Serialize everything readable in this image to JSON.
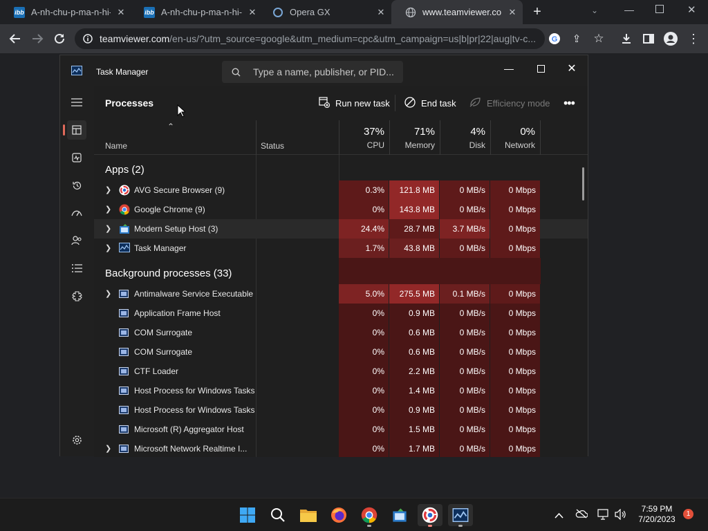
{
  "browser": {
    "tabs": [
      {
        "title": "A-nh-chu-p-ma-n-hi-nh",
        "favicon": "ibb-logo-icon",
        "fav_text": "ibb"
      },
      {
        "title": "A-nh-chu-p-ma-n-hi-nh",
        "favicon": "ibb-logo-icon",
        "fav_text": "ibb"
      },
      {
        "title": "Opera GX",
        "favicon": "opera-gx-icon",
        "fav_text": ""
      },
      {
        "title": "www.teamviewer.com",
        "favicon": "globe-icon",
        "fav_text": ""
      }
    ],
    "url_host": "teamviewer.com",
    "url_rest": "/en-us/?utm_source=google&utm_medium=cpc&utm_campaign=us|b|pr|22|aug|tv-c..."
  },
  "task_manager": {
    "title": "Task Manager",
    "search_placeholder": "Type a name, publisher, or PID...",
    "page_title": "Processes",
    "commands": {
      "run_new_task": "Run new task",
      "end_task": "End task",
      "efficiency_mode": "Efficiency mode"
    },
    "columns": {
      "name": "Name",
      "status": "Status",
      "cpu_pct": "37%",
      "cpu": "CPU",
      "memory_pct": "71%",
      "memory": "Memory",
      "disk_pct": "4%",
      "disk": "Disk",
      "network_pct": "0%",
      "network": "Network"
    },
    "groups": {
      "apps": "Apps (2)",
      "background": "Background processes (33)"
    },
    "apps": [
      {
        "name": "AVG Secure Browser (9)",
        "icon": "avg-browser-icon",
        "cpu": "0.3%",
        "memory": "121.8 MB",
        "disk": "0 MB/s",
        "network": "0 Mbps"
      },
      {
        "name": "Google Chrome (9)",
        "icon": "chrome-icon",
        "cpu": "0%",
        "memory": "143.8 MB",
        "disk": "0 MB/s",
        "network": "0 Mbps"
      },
      {
        "name": "Modern Setup Host (3)",
        "icon": "setup-host-icon",
        "cpu": "24.4%",
        "memory": "28.7 MB",
        "disk": "3.7 MB/s",
        "network": "0 Mbps"
      },
      {
        "name": "Task Manager",
        "icon": "task-manager-icon",
        "cpu": "1.7%",
        "memory": "43.8 MB",
        "disk": "0 MB/s",
        "network": "0 Mbps"
      }
    ],
    "background": [
      {
        "name": "Antimalware Service Executable",
        "expandable": true,
        "cpu": "5.0%",
        "memory": "275.5 MB",
        "disk": "0.1 MB/s",
        "network": "0 Mbps"
      },
      {
        "name": "Application Frame Host",
        "expandable": false,
        "cpu": "0%",
        "memory": "0.9 MB",
        "disk": "0 MB/s",
        "network": "0 Mbps"
      },
      {
        "name": "COM Surrogate",
        "expandable": false,
        "cpu": "0%",
        "memory": "0.6 MB",
        "disk": "0 MB/s",
        "network": "0 Mbps"
      },
      {
        "name": "COM Surrogate",
        "expandable": false,
        "cpu": "0%",
        "memory": "0.6 MB",
        "disk": "0 MB/s",
        "network": "0 Mbps"
      },
      {
        "name": "CTF Loader",
        "expandable": false,
        "cpu": "0%",
        "memory": "2.2 MB",
        "disk": "0 MB/s",
        "network": "0 Mbps"
      },
      {
        "name": "Host Process for Windows Tasks",
        "expandable": false,
        "cpu": "0%",
        "memory": "1.4 MB",
        "disk": "0 MB/s",
        "network": "0 Mbps"
      },
      {
        "name": "Host Process for Windows Tasks",
        "expandable": false,
        "cpu": "0%",
        "memory": "0.9 MB",
        "disk": "0 MB/s",
        "network": "0 Mbps"
      },
      {
        "name": "Microsoft (R) Aggregator Host",
        "expandable": false,
        "cpu": "0%",
        "memory": "1.5 MB",
        "disk": "0 MB/s",
        "network": "0 Mbps"
      },
      {
        "name": "Microsoft Network Realtime I...",
        "expandable": true,
        "cpu": "0%",
        "memory": "1.7 MB",
        "disk": "0 MB/s",
        "network": "0 Mbps"
      }
    ]
  },
  "taskbar": {
    "apps": [
      "windows-start-icon",
      "search-icon",
      "file-explorer-icon",
      "firefox-icon",
      "chrome-icon",
      "setup-icon",
      "avg-browser-icon",
      "task-manager-icon"
    ],
    "time": "7:59 PM",
    "date": "7/20/2023",
    "notifications": "1"
  },
  "colors": {
    "heat_low": "#4a1616",
    "heat_mid": "#6b1f1f",
    "heat_high": "#922828",
    "window_bg": "#202020"
  }
}
